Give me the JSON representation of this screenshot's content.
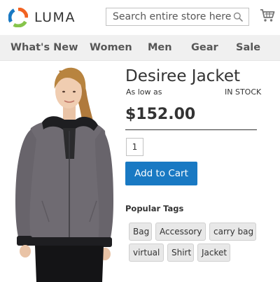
{
  "header": {
    "logo_text": "LUMA",
    "search": {
      "placeholder": "Search entire store here..."
    }
  },
  "nav": {
    "items": [
      {
        "label": "What's New"
      },
      {
        "label": "Women"
      },
      {
        "label": "Men"
      },
      {
        "label": "Gear"
      },
      {
        "label": "Sale"
      }
    ]
  },
  "product": {
    "name": "Desiree Jacket",
    "as_low_as": "As low as",
    "stock_status": "IN STOCK",
    "price": "$152.00",
    "qty": "1",
    "add_to_cart_label": "Add to Cart"
  },
  "tags": {
    "title": "Popular Tags",
    "items": [
      "Bag",
      "Accessory",
      "carry bag",
      "virtual",
      "Shirt",
      "Jacket"
    ]
  },
  "colors": {
    "accent": "#1979c3",
    "nav_background": "#f0f0f0",
    "logo_orange": "#f26322",
    "logo_blue": "#1979c3",
    "logo_green": "#86c44b"
  },
  "icons": [
    "luma-logo-icon",
    "search-icon",
    "cart-icon"
  ]
}
